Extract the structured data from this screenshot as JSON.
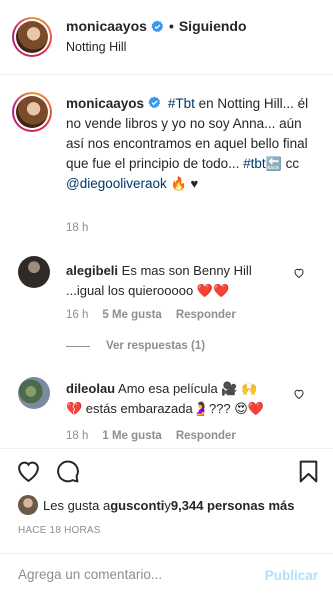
{
  "header": {
    "username": "monicaayos",
    "separator": "•",
    "follow_status": "Siguiendo",
    "location": "Notting Hill"
  },
  "caption": {
    "username": "monicaayos",
    "hashtag1": "#Tbt",
    "text1": " en Notting Hill... él no vende libros y yo no soy Anna... aún así nos encontramos en aquel bello final que fue el principio de todo... ",
    "hashtag2": "#tbt",
    "back_emoji": "🔙",
    "text2": " cc ",
    "mention": "@diegooliveraok",
    "fire_emoji": "🔥",
    "heart_emoji": "♥",
    "time": "18 h"
  },
  "comments": [
    {
      "username": "alegibeli",
      "text": "Es mas son Benny Hill ...igual los quierooooo",
      "emojis": "❤️❤️",
      "time": "16 h",
      "likes": "5 Me gusta",
      "reply": "Responder"
    },
    {
      "username": "dileolau",
      "text_a": "Amo esa película ",
      "emojis_a": "🎥 🙌",
      "text_b": " estás embarazada",
      "emojis_b_pre": "💔",
      "emojis_b_mid": "🤰",
      "text_c": "??? ",
      "emojis_c": "😍❤️",
      "time": "18 h",
      "likes": "1 Me gusta",
      "reply": "Responder"
    }
  ],
  "view_replies": "Ver respuestas (1)",
  "likes": {
    "prefix": "Les gusta a ",
    "user": "gusconti",
    "middle": " y ",
    "count": "9,344 personas más"
  },
  "post_time": "HACE 18 HORAS",
  "comment_box": {
    "placeholder": "Agrega un comentario...",
    "publish": "Publicar"
  },
  "colors": {
    "text": "#262626",
    "secondary": "#8e8e8e",
    "link": "#00376b",
    "verified": "#3897f0",
    "publish_disabled": "#b2dffc",
    "heart_red": "#ed4956"
  },
  "icons": [
    "verified-badge-icon",
    "heart-icon",
    "comment-icon",
    "bookmark-icon",
    "small-heart-icon"
  ]
}
